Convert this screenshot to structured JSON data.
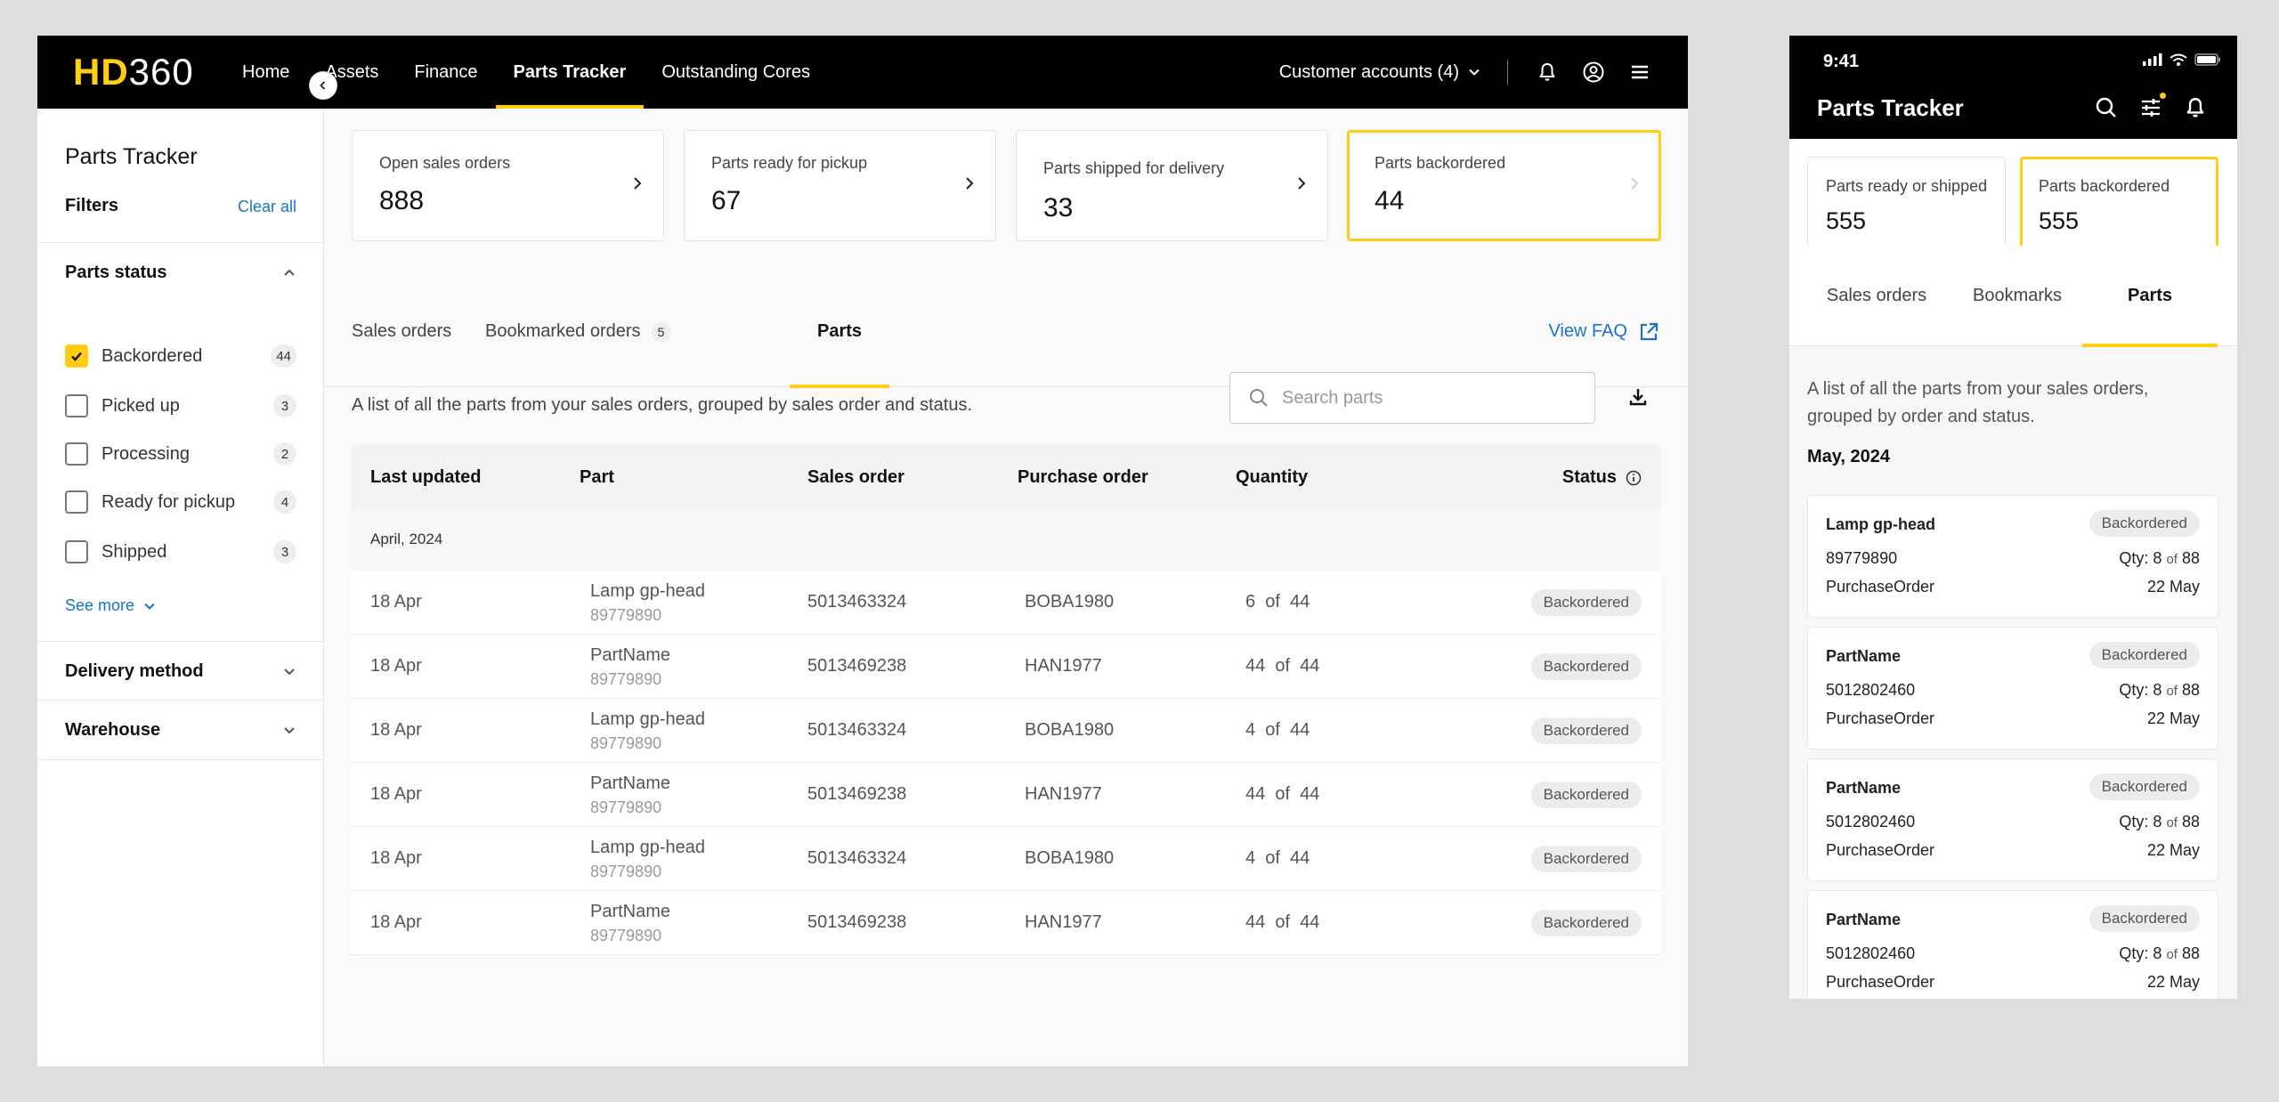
{
  "desktop": {
    "logo": {
      "hd": "HD",
      "num": "360"
    },
    "nav": [
      {
        "label": "Home",
        "active": false
      },
      {
        "label": "Assets",
        "active": false
      },
      {
        "label": "Finance",
        "active": false
      },
      {
        "label": "Parts Tracker",
        "active": true
      },
      {
        "label": "Outstanding Cores",
        "active": false
      }
    ],
    "account": {
      "label": "Customer accounts (4)"
    },
    "icons": {
      "notifications": "bell-icon",
      "profile": "user-circle-icon",
      "menu": "hamburger-menu-icon"
    },
    "sidebar": {
      "title": "Parts Tracker",
      "filters_label": "Filters",
      "clear_all": "Clear all",
      "parts_status": {
        "heading": "Parts status",
        "options": [
          {
            "label": "Backordered",
            "count": "44",
            "checked": true
          },
          {
            "label": "Picked up",
            "count": "3",
            "checked": false
          },
          {
            "label": "Processing",
            "count": "2",
            "checked": false
          },
          {
            "label": "Ready for pickup",
            "count": "4",
            "checked": false
          },
          {
            "label": "Shipped",
            "count": "3",
            "checked": false
          }
        ],
        "see_more": "See more"
      },
      "delivery_method": "Delivery method",
      "warehouse": "Warehouse"
    },
    "kpis": [
      {
        "label": "Open sales orders",
        "value": "888",
        "selected": false
      },
      {
        "label": "Parts ready for pickup",
        "value": "67",
        "selected": false
      },
      {
        "label": "Parts shipped for delivery",
        "value": "33",
        "selected": false
      },
      {
        "label": "Parts backordered",
        "value": "44",
        "selected": true
      }
    ],
    "tabs": [
      {
        "label": "Sales orders",
        "badge": "",
        "active": false
      },
      {
        "label": "Bookmarked orders",
        "badge": "5",
        "active": false
      },
      {
        "label": "Parts",
        "badge": "",
        "active": true
      }
    ],
    "view_faq": "View FAQ",
    "description": "A list of all the parts from your sales orders, grouped by sales order and status.",
    "search": {
      "placeholder": "Search parts",
      "value": ""
    },
    "table": {
      "columns": [
        "Last updated",
        "Part",
        "Sales order",
        "Purchase order",
        "Quantity",
        "Status"
      ],
      "group": "April, 2024",
      "rows": [
        {
          "date": "18 Apr",
          "part": "Lamp gp-head",
          "part_no": "89779890",
          "sales_order": "5013463324",
          "purchase_order": "BOBA1980",
          "qty": "6",
          "of": "of",
          "total": "44",
          "status": "Backordered"
        },
        {
          "date": "18 Apr",
          "part": "PartName",
          "part_no": "89779890",
          "sales_order": "5013469238",
          "purchase_order": "HAN1977",
          "qty": "44",
          "of": "of",
          "total": "44",
          "status": "Backordered"
        },
        {
          "date": "18 Apr",
          "part": "Lamp gp-head",
          "part_no": "89779890",
          "sales_order": "5013463324",
          "purchase_order": "BOBA1980",
          "qty": "4",
          "of": "of",
          "total": "44",
          "status": "Backordered"
        },
        {
          "date": "18 Apr",
          "part": "PartName",
          "part_no": "89779890",
          "sales_order": "5013469238",
          "purchase_order": "HAN1977",
          "qty": "44",
          "of": "of",
          "total": "44",
          "status": "Backordered"
        },
        {
          "date": "18 Apr",
          "part": "Lamp gp-head",
          "part_no": "89779890",
          "sales_order": "5013463324",
          "purchase_order": "BOBA1980",
          "qty": "4",
          "of": "of",
          "total": "44",
          "status": "Backordered"
        },
        {
          "date": "18 Apr",
          "part": "PartName",
          "part_no": "89779890",
          "sales_order": "5013469238",
          "purchase_order": "HAN1977",
          "qty": "44",
          "of": "of",
          "total": "44",
          "status": "Backordered"
        }
      ]
    }
  },
  "mobile": {
    "time": "9:41",
    "title": "Parts Tracker",
    "kpis": [
      {
        "label": "Parts ready or shipped",
        "value": "555",
        "selected": false
      },
      {
        "label": "Parts backordered",
        "value": "555",
        "selected": true
      }
    ],
    "tabs": [
      {
        "label": "Sales orders",
        "active": false
      },
      {
        "label": "Bookmarks",
        "active": false
      },
      {
        "label": "Parts",
        "active": true
      }
    ],
    "description": "A list of all the parts from your sales orders, grouped by order and status.",
    "month": "May, 2024",
    "cards": [
      {
        "title": "Lamp gp-head",
        "status": "Backordered",
        "part_no": "89779890",
        "qty_prefix": "Qty: 8",
        "of": "of",
        "total": "88",
        "po": "PurchaseOrder",
        "date": "22 May"
      },
      {
        "title": "PartName",
        "status": "Backordered",
        "part_no": "5012802460",
        "qty_prefix": "Qty: 8",
        "of": "of",
        "total": "88",
        "po": "PurchaseOrder",
        "date": "22 May"
      },
      {
        "title": "PartName",
        "status": "Backordered",
        "part_no": "5012802460",
        "qty_prefix": "Qty: 8",
        "of": "of",
        "total": "88",
        "po": "PurchaseOrder",
        "date": "22 May"
      },
      {
        "title": "PartName",
        "status": "Backordered",
        "part_no": "5012802460",
        "qty_prefix": "Qty: 8",
        "of": "of",
        "total": "88",
        "po": "PurchaseOrder",
        "date": "22 May"
      }
    ]
  },
  "colors": {
    "accent": "#ffcd11",
    "link": "#1a73c8",
    "header": "#000000"
  }
}
